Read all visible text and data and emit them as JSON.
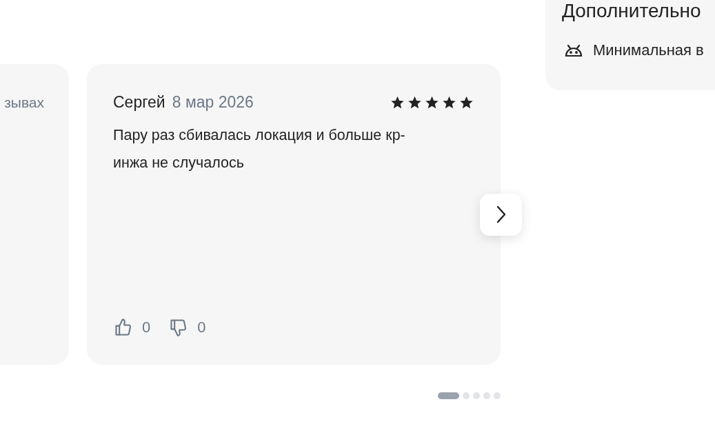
{
  "previous_review": {
    "text": "зывах"
  },
  "review": {
    "author": "Сергей",
    "date": "8 мар 2026",
    "stars": 5,
    "text": "Пару раз сбивалась локация и больше кр-\nинжа не случалось",
    "likes": "0",
    "dislikes": "0"
  },
  "pagination": [
    {
      "selected": true
    },
    {
      "selected": false
    },
    {
      "selected": false
    },
    {
      "selected": false
    },
    {
      "selected": false
    }
  ],
  "side_panel": {
    "title": "Дополнительно",
    "rows": [
      {
        "kind": "android",
        "text": "Минимальная в"
      }
    ]
  }
}
